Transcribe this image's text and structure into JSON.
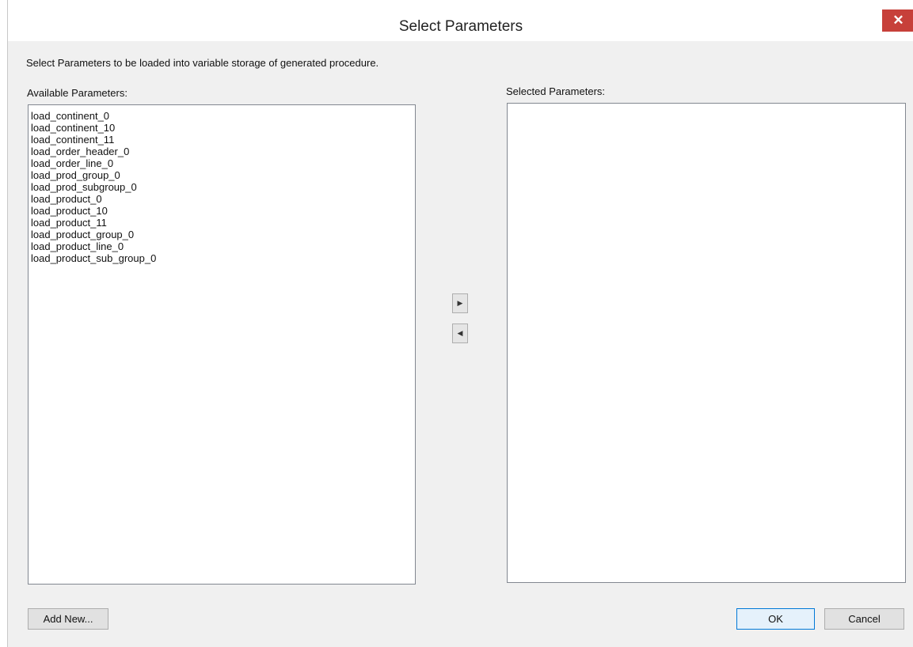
{
  "dialog": {
    "title": "Select Parameters",
    "close_glyph": "✕",
    "description": "Select Parameters to be loaded into variable storage of generated procedure."
  },
  "available": {
    "label": "Available Parameters:",
    "items": [
      "load_continent_0",
      "load_continent_10",
      "load_continent_11",
      "load_order_header_0",
      "load_order_line_0",
      "load_prod_group_0",
      "load_prod_subgroup_0",
      "load_product_0",
      "load_product_10",
      "load_product_11",
      "load_product_group_0",
      "load_product_line_0",
      "load_product_sub_group_0"
    ]
  },
  "selected": {
    "label": "Selected Parameters:",
    "items": []
  },
  "transfer": {
    "add_glyph": "▶",
    "remove_glyph": "◀",
    "add_icon": "arrow-right-icon",
    "remove_icon": "arrow-left-icon"
  },
  "buttons": {
    "add_new": "Add New...",
    "ok": "OK",
    "cancel": "Cancel"
  },
  "colors": {
    "close_button": "#c7403a",
    "default_button_border": "#0078d7",
    "dialog_background": "#f0f0f0"
  }
}
